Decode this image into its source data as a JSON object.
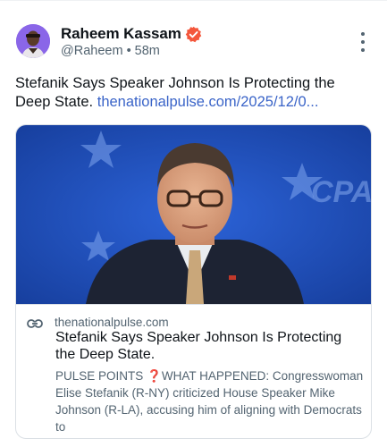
{
  "author": {
    "display_name": "Raheem Kassam",
    "handle": "@Raheem",
    "separator": "•",
    "time": "58m",
    "avatar_icon": "person-avatar",
    "verified_icon": "verified-badge-icon",
    "verified_color": "#f4573c"
  },
  "post": {
    "text": "Stefanik Says Speaker Johnson Is Protecting the Deep State. ",
    "link_text": "thenationalpulse.com/2025/12/0..."
  },
  "card": {
    "image_icon": "speaker-photo",
    "domain": "thenationalpulse.com",
    "title": "Stefanik Says Speaker Johnson Is Protecting the Deep State.",
    "desc_prefix": "PULSE POINTS ",
    "desc_emoji": "❓",
    "desc_rest": "WHAT HAPPENED: Congresswoman Elise Stefanik (R-NY) criticized House Speaker Mike Johnson (R-LA), accusing him of aligning with Democrats to",
    "backdrop_text": "CPAC"
  },
  "colors": {
    "link": "#3a64c8",
    "muted": "#536471",
    "backdrop_blue": "#1e4fc2"
  },
  "icons": {
    "more": "more-vertical-icon",
    "link": "link-icon"
  }
}
